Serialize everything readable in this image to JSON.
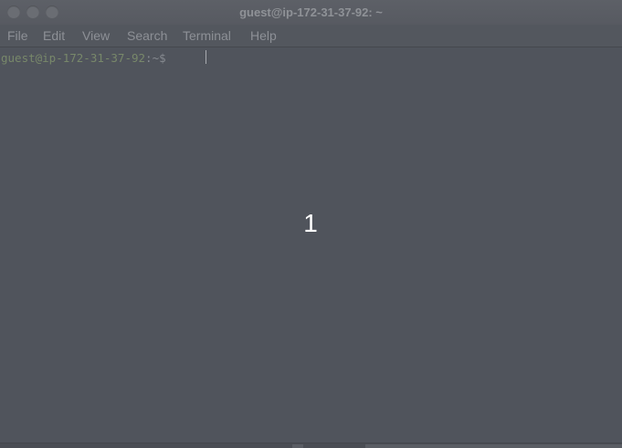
{
  "window": {
    "title": "guest@ip-172-31-37-92: ~"
  },
  "menu": {
    "items": [
      "File",
      "Edit",
      "View",
      "Search",
      "Terminal",
      "Help"
    ]
  },
  "terminal": {
    "prompt_user_host": "guest@ip-172-31-37-92",
    "prompt_suffix": ":~$ "
  },
  "overlay": {
    "number": "1"
  },
  "colors": {
    "terminal_bg": "#50545c",
    "titlebar_bg": "#5a5d64",
    "prompt_user": "#78886a",
    "overlay_text": "#ffffff"
  }
}
